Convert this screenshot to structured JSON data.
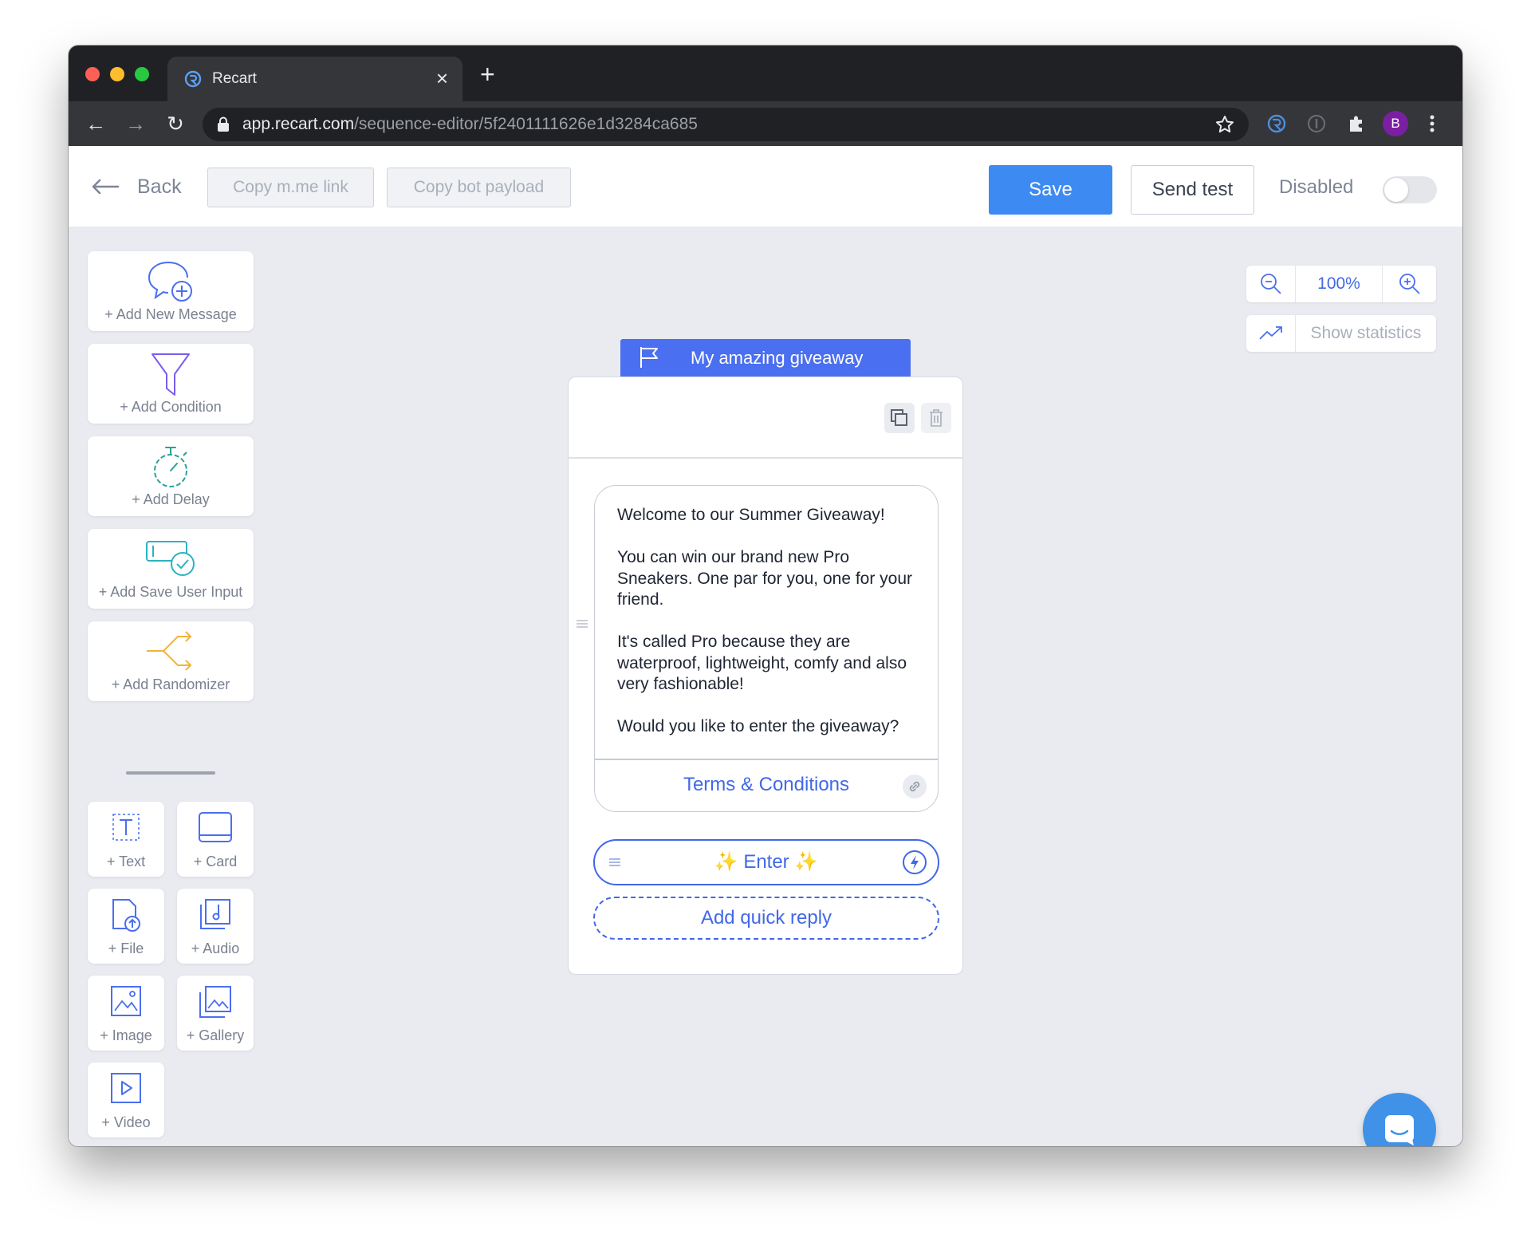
{
  "browser": {
    "tab_title": "Recart",
    "url_host": "app.recart.com",
    "url_path": "/sequence-editor/5f2401111626e1d3284ca685",
    "profile_initial": "B"
  },
  "header": {
    "back_label": "Back",
    "copy_mme_label": "Copy m.me link",
    "copy_payload_label": "Copy bot payload",
    "save_label": "Save",
    "send_test_label": "Send test",
    "status_label": "Disabled",
    "accent_color": "#3d8bf2"
  },
  "toolbox": {
    "add_message": "+ Add New Message",
    "add_condition": "+ Add Condition",
    "add_delay": "+ Add Delay",
    "add_save_input": "+ Add Save User Input",
    "add_randomizer": "+ Add Randomizer",
    "text": "+ Text",
    "card": "+ Card",
    "file": "+ File",
    "audio": "+ Audio",
    "image": "+ Image",
    "gallery": "+ Gallery",
    "video": "+ Video"
  },
  "node": {
    "title": "My amazing giveaway",
    "message": {
      "p1": "Welcome to our Summer Giveaway!",
      "p2": "You can win our brand new Pro Sneakers. One par for you, one for your friend.",
      "p3": "It's called Pro because they are waterproof, lightweight, comfy and also very fashionable!",
      "p4": "Would you like to enter the giveaway?"
    },
    "link_button": "Terms & Conditions",
    "quick_reply": {
      "sparkle": "✨",
      "label": "Enter"
    },
    "add_quick_reply": "Add quick reply",
    "accent_color": "#4a6ff0"
  },
  "zoom": {
    "level": "100%",
    "stats_label": "Show statistics"
  }
}
